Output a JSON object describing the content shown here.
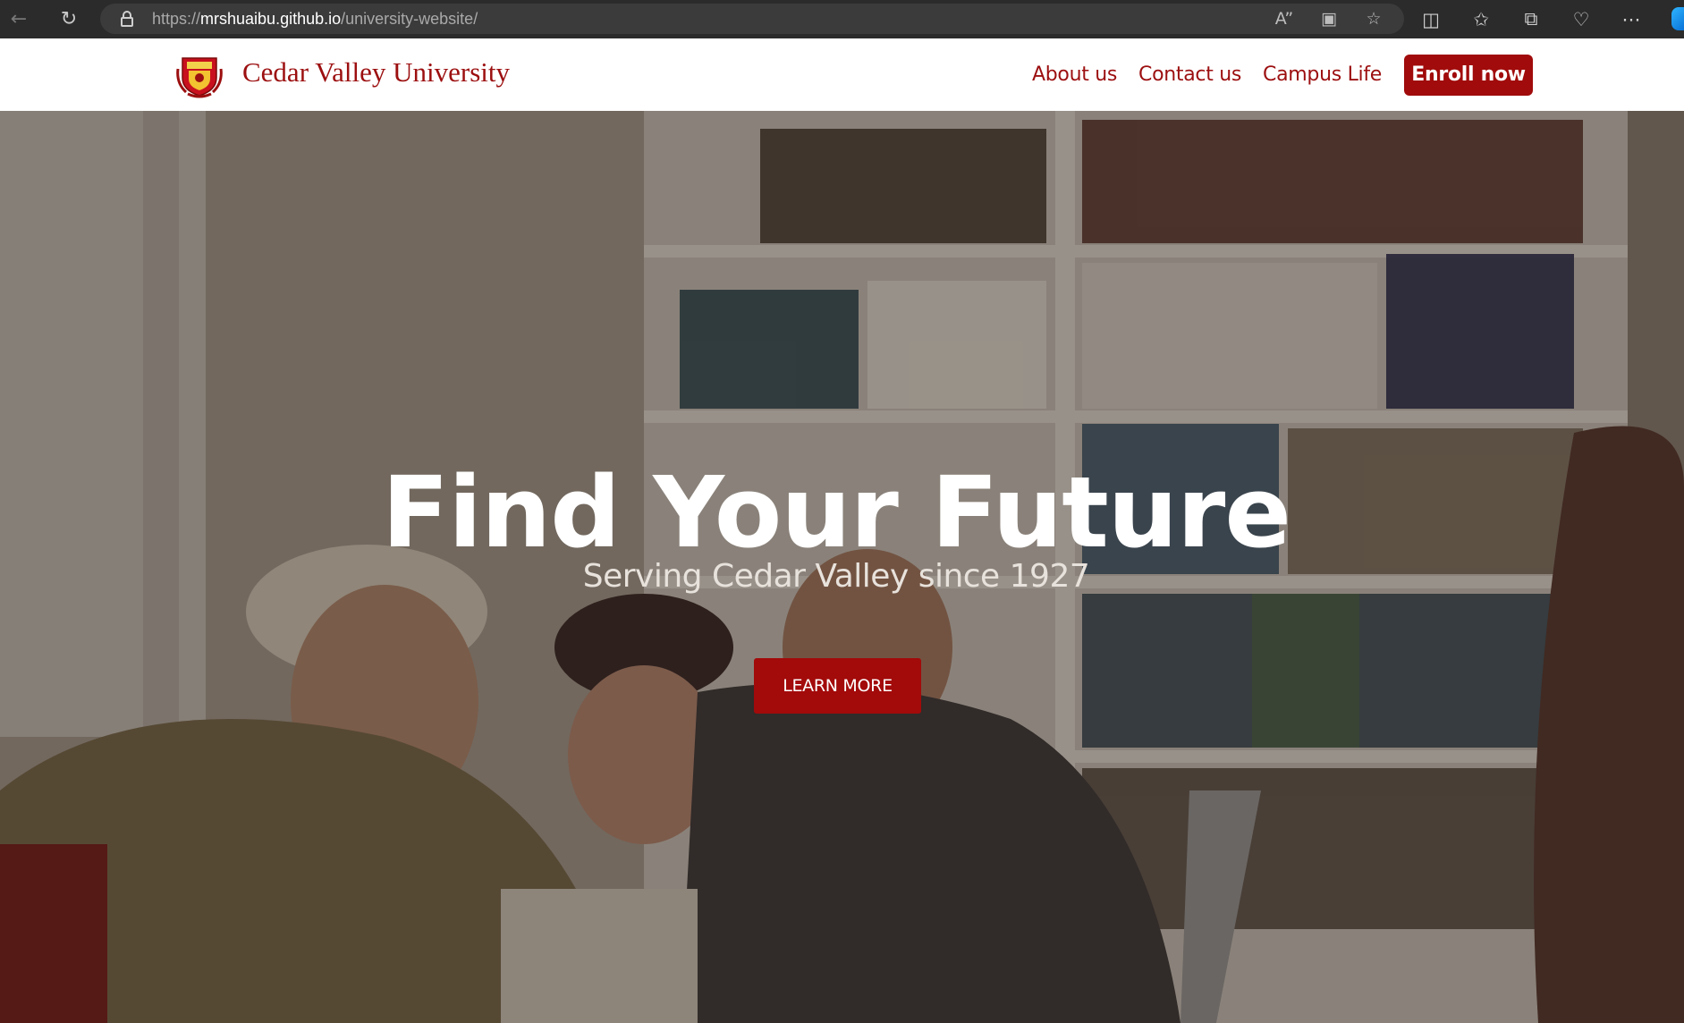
{
  "browser": {
    "url_scheme": "https://",
    "url_host": "mrshuaibu.github.io",
    "url_path": "/university-website/",
    "icons": [
      "back-arrow-icon",
      "reload-icon",
      "lock-icon",
      "read-aloud-icon",
      "immersive-reader-icon",
      "favorite-star-icon",
      "split-screen-icon",
      "favorites-icon",
      "collections-icon",
      "browser-essentials-icon",
      "more-icon"
    ]
  },
  "header": {
    "brand": "Cedar Valley University",
    "nav": [
      {
        "label": "About us"
      },
      {
        "label": "Contact us"
      },
      {
        "label": "Campus Life"
      }
    ],
    "cta": "Enroll now"
  },
  "hero": {
    "title": "Find Your Future",
    "subtitle": "Serving Cedar Valley since 1927",
    "button": "LEARN MORE"
  },
  "colors": {
    "brand_red": "#9c0f10",
    "button_red": "#a30a0a",
    "header_bg": "#ffffff",
    "browser_bg": "#2b2b2b"
  }
}
